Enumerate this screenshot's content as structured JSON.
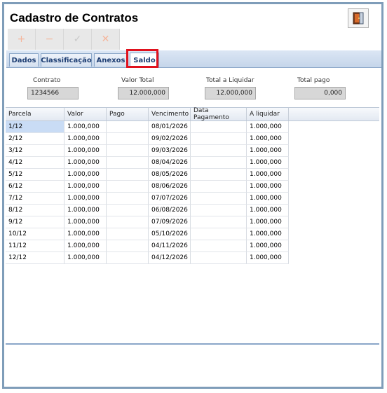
{
  "window": {
    "title": "Cadastro de Contratos",
    "exit_icon": "door-exit-icon"
  },
  "toolbar": {
    "add_label": "+",
    "remove_label": "−",
    "confirm_label": "✓",
    "cancel_label": "✕"
  },
  "tabs": [
    {
      "label": "Dados"
    },
    {
      "label": "Classificação"
    },
    {
      "label": "Anexos"
    },
    {
      "label": "Saldo"
    }
  ],
  "summary": {
    "contrato_label": "Contrato",
    "contrato_value": "1234566",
    "valor_total_label": "Valor Total",
    "valor_total_value": "12.000,000",
    "total_liquidar_label": "Total a Liquidar",
    "total_liquidar_value": "12.000,000",
    "total_pago_label": "Total pago",
    "total_pago_value": "0,000"
  },
  "grid": {
    "columns": [
      "Parcela",
      "Valor",
      "Pago",
      "Vencimento",
      "Data Pagamento",
      "A liquidar"
    ],
    "rows": [
      [
        "1/12",
        "1.000,000",
        "",
        "08/01/2026",
        "",
        "1.000,000"
      ],
      [
        "2/12",
        "1.000,000",
        "",
        "09/02/2026",
        "",
        "1.000,000"
      ],
      [
        "3/12",
        "1.000,000",
        "",
        "09/03/2026",
        "",
        "1.000,000"
      ],
      [
        "4/12",
        "1.000,000",
        "",
        "08/04/2026",
        "",
        "1.000,000"
      ],
      [
        "5/12",
        "1.000,000",
        "",
        "08/05/2026",
        "",
        "1.000,000"
      ],
      [
        "6/12",
        "1.000,000",
        "",
        "08/06/2026",
        "",
        "1.000,000"
      ],
      [
        "7/12",
        "1.000,000",
        "",
        "07/07/2026",
        "",
        "1.000,000"
      ],
      [
        "8/12",
        "1.000,000",
        "",
        "06/08/2026",
        "",
        "1.000,000"
      ],
      [
        "9/12",
        "1.000,000",
        "",
        "07/09/2026",
        "",
        "1.000,000"
      ],
      [
        "10/12",
        "1.000,000",
        "",
        "05/10/2026",
        "",
        "1.000,000"
      ],
      [
        "11/12",
        "1.000,000",
        "",
        "04/11/2026",
        "",
        "1.000,000"
      ],
      [
        "12/12",
        "1.000,000",
        "",
        "04/12/2026",
        "",
        "1.000,000"
      ]
    ]
  }
}
